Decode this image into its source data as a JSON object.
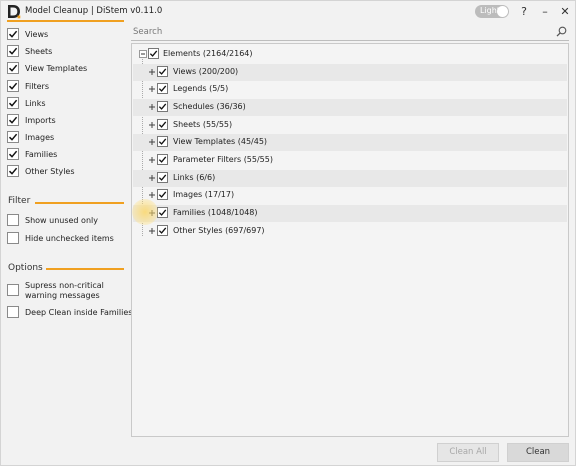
{
  "window": {
    "title": "Model Cleanup | DiStem v0.11.0",
    "theme_toggle_label": "Light",
    "help_label": "?",
    "minimize_label": "–",
    "close_label": "✕"
  },
  "categories": [
    {
      "label": "Views",
      "checked": true
    },
    {
      "label": "Sheets",
      "checked": true
    },
    {
      "label": "View Templates",
      "checked": true
    },
    {
      "label": "Filters",
      "checked": true
    },
    {
      "label": "Links",
      "checked": true
    },
    {
      "label": "Imports",
      "checked": true
    },
    {
      "label": "Images",
      "checked": true
    },
    {
      "label": "Families",
      "checked": true
    },
    {
      "label": "Other Styles",
      "checked": true
    }
  ],
  "filter": {
    "title": "Filter",
    "options": [
      {
        "label": "Show unused only",
        "checked": false
      },
      {
        "label": "Hide unchecked items",
        "checked": false
      }
    ]
  },
  "options": {
    "title": "Options",
    "items": [
      {
        "label": "Supress non-critical warning messages",
        "checked": false
      },
      {
        "label": "Deep Clean inside Families",
        "checked": false
      }
    ]
  },
  "search": {
    "placeholder": "Search",
    "value": ""
  },
  "tree": {
    "root": {
      "label": "Elements (2164/2164)",
      "checked": true,
      "expanded": true
    },
    "children": [
      {
        "label": "Views (200/200)",
        "checked": true
      },
      {
        "label": "Legends (5/5)",
        "checked": true
      },
      {
        "label": "Schedules (36/36)",
        "checked": true
      },
      {
        "label": "Sheets (55/55)",
        "checked": true
      },
      {
        "label": "View Templates (45/45)",
        "checked": true
      },
      {
        "label": "Parameter Filters (55/55)",
        "checked": true
      },
      {
        "label": "Links (6/6)",
        "checked": true
      },
      {
        "label": "Images (17/17)",
        "checked": true
      },
      {
        "label": "Families (1048/1048)",
        "checked": true
      },
      {
        "label": "Other Styles (697/697)",
        "checked": true
      }
    ]
  },
  "buttons": {
    "clean_all": "Clean All",
    "clean": "Clean"
  },
  "colors": {
    "accent": "#f0a020",
    "panel_bg": "#f4f4f4",
    "stripe": "#e8e8e8"
  }
}
